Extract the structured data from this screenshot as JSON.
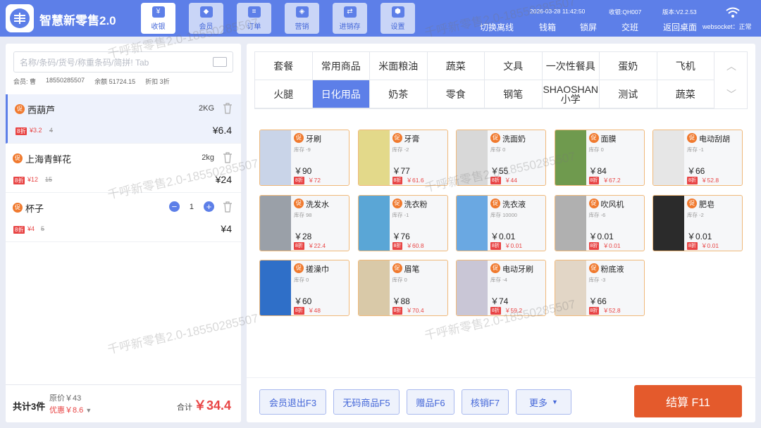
{
  "app": {
    "title": "智慧新零售2.0"
  },
  "nav": [
    {
      "label": "收银",
      "icon": "cashier-icon",
      "active": true
    },
    {
      "label": "会员",
      "icon": "diamond-icon",
      "active": false
    },
    {
      "label": "订单",
      "icon": "order-icon",
      "active": false
    },
    {
      "label": "营销",
      "icon": "tag-icon",
      "active": false
    },
    {
      "label": "进销存",
      "icon": "exchange-icon",
      "active": false
    },
    {
      "label": "设置",
      "icon": "gear-icon",
      "active": false
    }
  ],
  "status": {
    "datetime": "2026-03-28 11:42:50",
    "cashier": "收银:QH007",
    "version": "版本:V2.2.53",
    "websocket": "websocket：正常"
  },
  "actions": [
    "切换离线",
    "钱箱",
    "锁屏",
    "交班",
    "返回桌面"
  ],
  "cart": {
    "search_placeholder": "名称/条码/货号/称重条码/简拼! Tab",
    "member": {
      "label": "会员: 曹",
      "phone": "18550285507",
      "balance": "余额 51724.15",
      "discount": "折扣 3折"
    },
    "items": [
      {
        "badge": "促",
        "name": "西葫芦",
        "unit": "2KG",
        "tag": "8折",
        "price": "¥3.2",
        "orig": "4",
        "total": "¥6.4",
        "selected": true
      },
      {
        "badge": "促",
        "name": "上海青鲜花",
        "unit": "2kg",
        "tag": "8折",
        "price": "¥12",
        "orig": "15",
        "total": "¥24",
        "selected": false
      },
      {
        "badge": "促",
        "name": "杯子",
        "qty": "1",
        "tag": "8折",
        "price": "¥4",
        "orig": "5",
        "total": "¥4",
        "selected": false
      }
    ],
    "footer": {
      "count": "共计3件",
      "orig_sum": "原价￥43",
      "discount_sum": "优惠￥8.6",
      "total_label": "合计",
      "total": "￥34.4"
    }
  },
  "categories": [
    "套餐",
    "常用商品",
    "米面粮油",
    "蔬菜",
    "文具",
    "一次性餐具",
    "蛋奶",
    "飞机",
    "火腿",
    "日化用品",
    "奶茶",
    "零食",
    "钢笔",
    "SHAOSHAN小学",
    "测试",
    "蔬菜"
  ],
  "active_category": "日化用品",
  "products": [
    {
      "name": "牙刷",
      "stock": "库存 -9",
      "price": "￥90",
      "tag": "8折",
      "disc": "￥72"
    },
    {
      "name": "牙膏",
      "stock": "库存 -2",
      "price": "￥77",
      "tag": "8折",
      "disc": "￥61.6"
    },
    {
      "name": "洗面奶",
      "stock": "库存 0",
      "price": "￥55",
      "tag": "8折",
      "disc": "￥44"
    },
    {
      "name": "面膜",
      "stock": "库存 0",
      "price": "￥84",
      "tag": "8折",
      "disc": "￥67.2"
    },
    {
      "name": "电动刮胡",
      "stock": "库存 -1",
      "price": "￥66",
      "tag": "8折",
      "disc": "￥52.8"
    },
    {
      "name": "洗发水",
      "stock": "库存 98",
      "price": "￥28",
      "tag": "8折",
      "disc": "￥22.4"
    },
    {
      "name": "洗衣粉",
      "stock": "库存 -1",
      "price": "￥76",
      "tag": "8折",
      "disc": "￥60.8"
    },
    {
      "name": "洗衣液",
      "stock": "库存 10000",
      "price": "￥0.01",
      "tag": "8折",
      "disc": "￥0.01"
    },
    {
      "name": "吹风机",
      "stock": "库存 -6",
      "price": "￥0.01",
      "tag": "8折",
      "disc": "￥0.01"
    },
    {
      "name": "肥皂",
      "stock": "库存 -2",
      "price": "￥0.01",
      "tag": "8折",
      "disc": "￥0.01"
    },
    {
      "name": "搓澡巾",
      "stock": "库存 0",
      "price": "￥60",
      "tag": "8折",
      "disc": "￥48"
    },
    {
      "name": "眉笔",
      "stock": "库存 0",
      "price": "￥88",
      "tag": "8折",
      "disc": "￥70.4"
    },
    {
      "name": "电动牙刷",
      "stock": "库存 -4",
      "price": "￥74",
      "tag": "8折",
      "disc": "￥59.2"
    },
    {
      "name": "粉底液",
      "stock": "库存 -3",
      "price": "￥66",
      "tag": "8折",
      "disc": "￥52.8"
    }
  ],
  "function_buttons": [
    "会员退出F3",
    "无码商品F5",
    "赠品F6",
    "核销F7",
    "更多"
  ],
  "checkout_label": "结算 F11",
  "watermark": "千呼新零售2.0-18550285507",
  "colors": {
    "primary": "#5d7fe8",
    "danger": "#e84545",
    "checkout": "#e45a2c",
    "promo": "#f07a2f"
  }
}
